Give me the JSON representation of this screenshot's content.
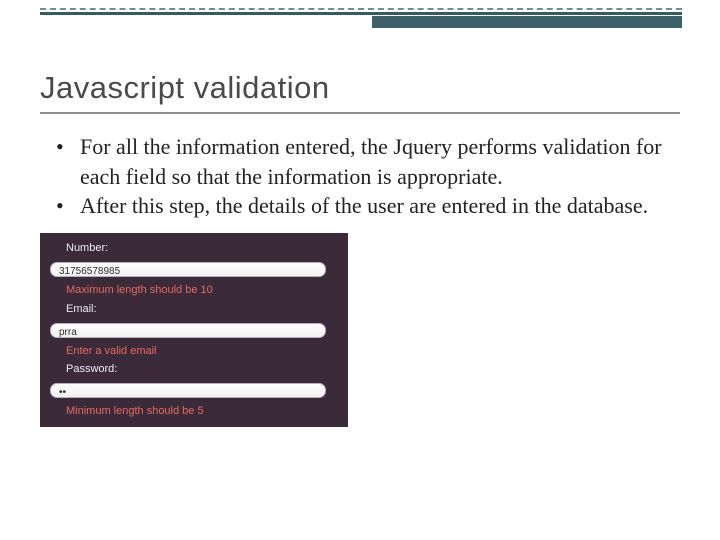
{
  "title": "Javascript validation",
  "bullets": [
    "For all the information entered, the Jquery performs validation for each field so that the information is appropriate.",
    "After this step, the details of the user are entered in the database."
  ],
  "form": {
    "number_label": "Number:",
    "number_value": "31756578985",
    "number_error": "Maximum length should be 10",
    "email_label": "Email:",
    "email_value": "prra",
    "email_error": "Enter a valid email",
    "password_label": "Password:",
    "password_value": "••",
    "password_error": "Minimum length should be 5"
  }
}
